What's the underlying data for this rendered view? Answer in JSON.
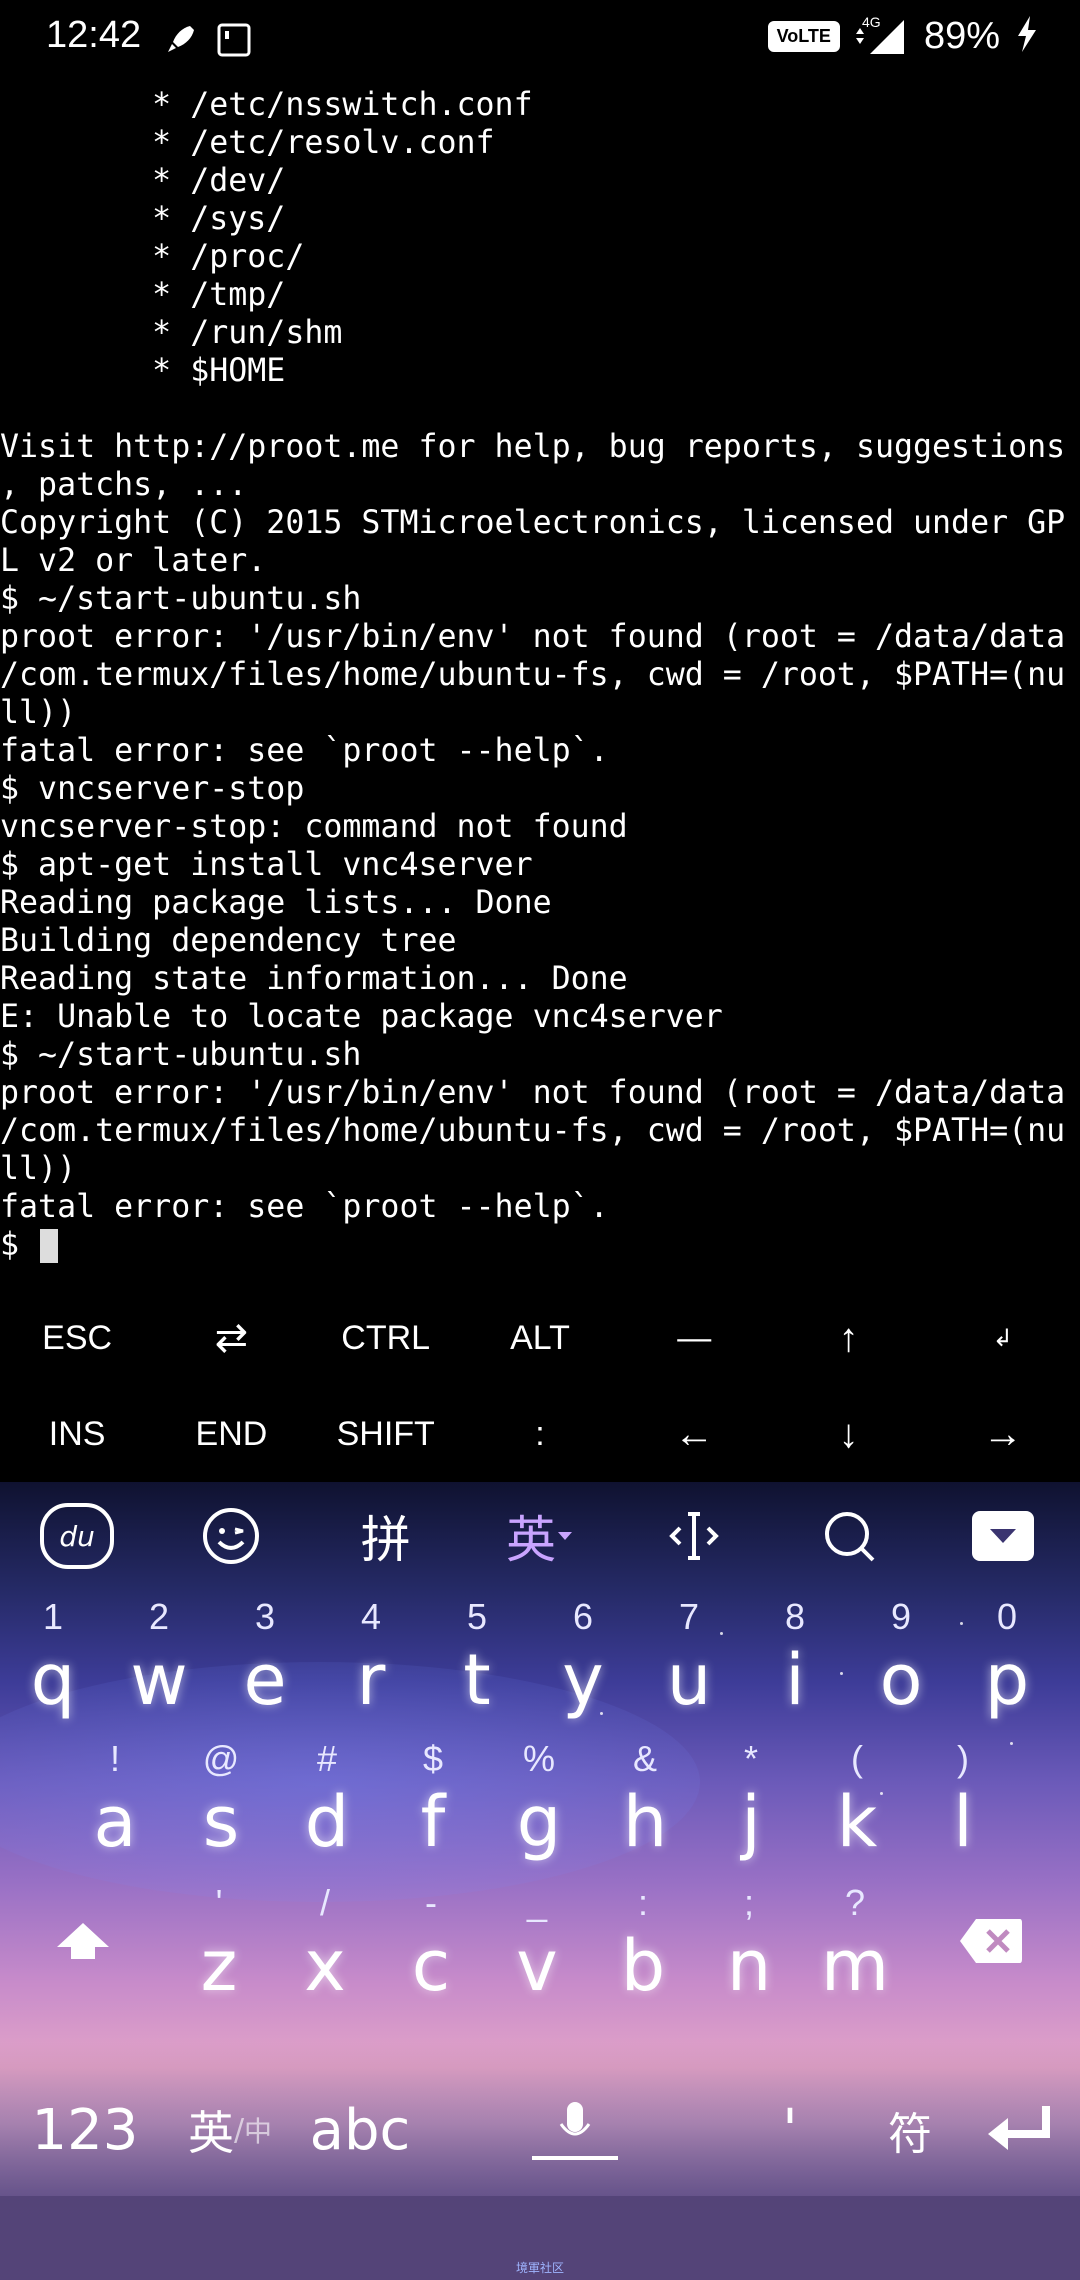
{
  "status_bar": {
    "time": "12:42",
    "icons": [
      "rocket-icon",
      "notification-square-icon"
    ],
    "network_badge": "VoLTE",
    "network_type": "4G",
    "battery": "89%",
    "charging_icon": "lightning-icon"
  },
  "terminal": {
    "lines": [
      "        * /etc/nsswitch.conf",
      "        * /etc/resolv.conf",
      "        * /dev/",
      "        * /sys/",
      "        * /proc/",
      "        * /tmp/",
      "        * /run/shm",
      "        * $HOME",
      "",
      "Visit http://proot.me for help, bug reports, suggestions",
      ", patchs, ...",
      "Copyright (C) 2015 STMicroelectronics, licensed under GP",
      "L v2 or later.",
      "$ ~/start-ubuntu.sh",
      "proot error: '/usr/bin/env' not found (root = /data/data",
      "/com.termux/files/home/ubuntu-fs, cwd = /root, $PATH=(nu",
      "ll))",
      "fatal error: see `proot --help`.",
      "$ vncserver-stop",
      "vncserver-stop: command not found",
      "$ apt-get install vnc4server",
      "Reading package lists... Done",
      "Building dependency tree",
      "Reading state information... Done",
      "E: Unable to locate package vnc4server",
      "$ ~/start-ubuntu.sh",
      "proot error: '/usr/bin/env' not found (root = /data/data",
      "/com.termux/files/home/ubuntu-fs, cwd = /root, $PATH=(nu",
      "ll))",
      "fatal error: see `proot --help`."
    ],
    "prompt": "$ "
  },
  "extra_keys": {
    "row1": [
      "ESC",
      "⇄",
      "CTRL",
      "ALT",
      "—",
      "↑",
      "↲"
    ],
    "row2": [
      "INS",
      "END",
      "SHIFT",
      ":",
      "←",
      "↓",
      "→"
    ]
  },
  "keyboard": {
    "toolbar": {
      "logo": "du",
      "pinyin": "拼",
      "english": "英",
      "collapse_icon": "chevron-down-icon"
    },
    "row1": [
      {
        "sub": "1",
        "main": "q"
      },
      {
        "sub": "2",
        "main": "w"
      },
      {
        "sub": "3",
        "main": "e"
      },
      {
        "sub": "4",
        "main": "r"
      },
      {
        "sub": "5",
        "main": "t"
      },
      {
        "sub": "6",
        "main": "y"
      },
      {
        "sub": "7",
        "main": "u"
      },
      {
        "sub": "8",
        "main": "i"
      },
      {
        "sub": "9",
        "main": "o"
      },
      {
        "sub": "0",
        "main": "p"
      }
    ],
    "row2": [
      {
        "sub": "!",
        "main": "a"
      },
      {
        "sub": "@",
        "main": "s"
      },
      {
        "sub": "#",
        "main": "d"
      },
      {
        "sub": "$",
        "main": "f"
      },
      {
        "sub": "%",
        "main": "g"
      },
      {
        "sub": "&",
        "main": "h"
      },
      {
        "sub": "*",
        "main": "j"
      },
      {
        "sub": "(",
        "main": "k"
      },
      {
        "sub": ")",
        "main": "l"
      }
    ],
    "row3": [
      {
        "sub": "'",
        "main": "z"
      },
      {
        "sub": "/",
        "main": "x"
      },
      {
        "sub": "-",
        "main": "c"
      },
      {
        "sub": "_",
        "main": "v"
      },
      {
        "sub": ":",
        "main": "b"
      },
      {
        "sub": ";",
        "main": "n"
      },
      {
        "sub": "?",
        "main": "m"
      }
    ],
    "bottom": {
      "numbers": "123",
      "lang_en": "英",
      "lang_zh": "中",
      "abc": "abc",
      "apostrophe": "'",
      "symbols": "符"
    }
  },
  "nav_bar": {
    "label": "境軍社区"
  }
}
